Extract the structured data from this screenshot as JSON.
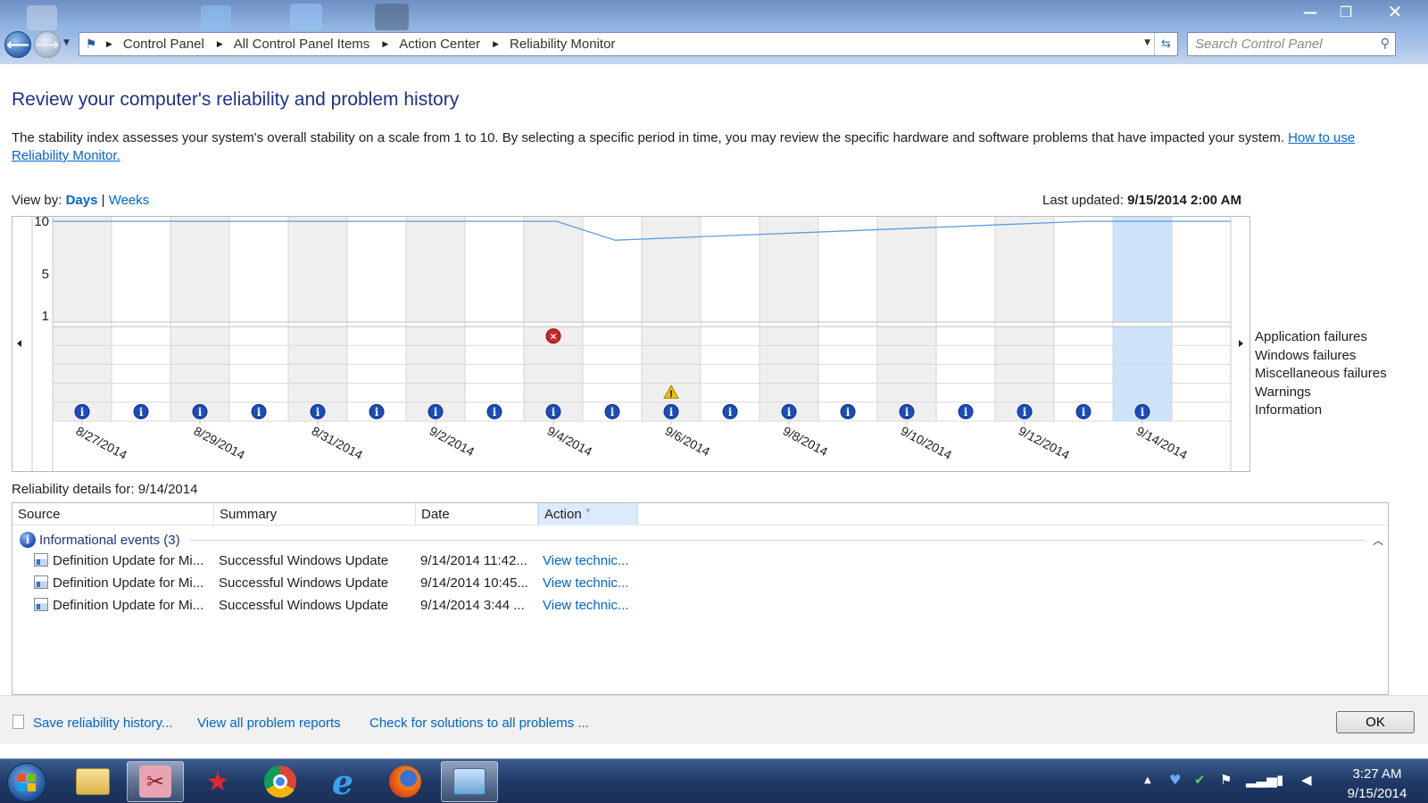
{
  "window": {
    "minimize_glyph": "—",
    "maximize_glyph": "❐",
    "close_glyph": "✕"
  },
  "nav": {
    "breadcrumbs": [
      "Control Panel",
      "All Control Panel Items",
      "Action Center",
      "Reliability Monitor"
    ],
    "search_placeholder": "Search Control Panel"
  },
  "page": {
    "title": "Review your computer's reliability and problem history",
    "description": "The stability index assesses your system's overall stability on a scale from 1 to 10. By selecting a specific period in time, you may review the specific hardware and software problems that have impacted your system.",
    "description_link": "How to use Reliability Monitor.",
    "view_by_label": "View by:",
    "view_days": "Days",
    "view_separator": "|",
    "view_weeks": "Weeks",
    "last_updated_label": "Last updated:",
    "last_updated_value": "9/15/2014 2:00 AM"
  },
  "chart_data": {
    "type": "line",
    "y_ticks": [
      "10",
      "5",
      "1"
    ],
    "ylim": [
      1,
      10
    ],
    "dates": [
      "8/27/2014",
      "8/28/2014",
      "8/29/2014",
      "8/30/2014",
      "8/31/2014",
      "9/1/2014",
      "9/2/2014",
      "9/3/2014",
      "9/4/2014",
      "9/5/2014",
      "9/6/2014",
      "9/7/2014",
      "9/8/2014",
      "9/9/2014",
      "9/10/2014",
      "9/11/2014",
      "9/12/2014",
      "9/13/2014",
      "9/14/2014",
      "9/15/2014"
    ],
    "x_tick_labels": [
      "8/27/2014",
      "8/29/2014",
      "8/31/2014",
      "9/2/2014",
      "9/4/2014",
      "9/6/2014",
      "9/8/2014",
      "9/10/2014",
      "9/12/2014",
      "9/14/2014"
    ],
    "stability_index": [
      {
        "date": "8/27/2014",
        "value": 10
      },
      {
        "date": "9/4/2014",
        "value": 10
      },
      {
        "date": "9/5/2014",
        "value": 8.2
      },
      {
        "date": "9/13/2014",
        "value": 10
      },
      {
        "date": "9/15/2014",
        "value": 10
      }
    ],
    "selected_date": "9/14/2014",
    "event_rows": [
      "Application failures",
      "Windows failures",
      "Miscellaneous failures",
      "Warnings",
      "Information"
    ],
    "events": {
      "Application failures": [
        "9/4/2014"
      ],
      "Windows failures": [],
      "Miscellaneous failures": [],
      "Warnings": [
        "9/6/2014"
      ],
      "Information": [
        "8/27/2014",
        "8/28/2014",
        "8/29/2014",
        "8/30/2014",
        "8/31/2014",
        "9/1/2014",
        "9/2/2014",
        "9/3/2014",
        "9/4/2014",
        "9/5/2014",
        "9/6/2014",
        "9/7/2014",
        "9/8/2014",
        "9/9/2014",
        "9/10/2014",
        "9/11/2014",
        "9/12/2014",
        "9/13/2014",
        "9/14/2014"
      ]
    },
    "colors": {
      "line": "#5a9ee0",
      "selected": "#cce3fa",
      "shade": "#efefef",
      "error": "#c8282d",
      "warning": "#f0c400",
      "info": "#1b4dbb"
    }
  },
  "details": {
    "label": "Reliability details for: 9/14/2014",
    "columns": [
      "Source",
      "Summary",
      "Date",
      "Action"
    ],
    "group_label": "Informational events (3)",
    "rows": [
      {
        "source": "Definition Update for Mi...",
        "summary": "Successful Windows Update",
        "date": "9/14/2014 11:42...",
        "action": "View  technic..."
      },
      {
        "source": "Definition Update for Mi...",
        "summary": "Successful Windows Update",
        "date": "9/14/2014 10:45...",
        "action": "View  technic..."
      },
      {
        "source": "Definition Update for Mi...",
        "summary": "Successful Windows Update",
        "date": "9/14/2014 3:44 ...",
        "action": "View  technic..."
      }
    ]
  },
  "footer": {
    "save_history": "Save reliability history...",
    "view_reports": "View all problem reports",
    "check_solutions": "Check for solutions to all problems ...",
    "ok": "OK"
  },
  "taskbar": {
    "time": "3:27 AM",
    "date": "9/15/2014"
  }
}
